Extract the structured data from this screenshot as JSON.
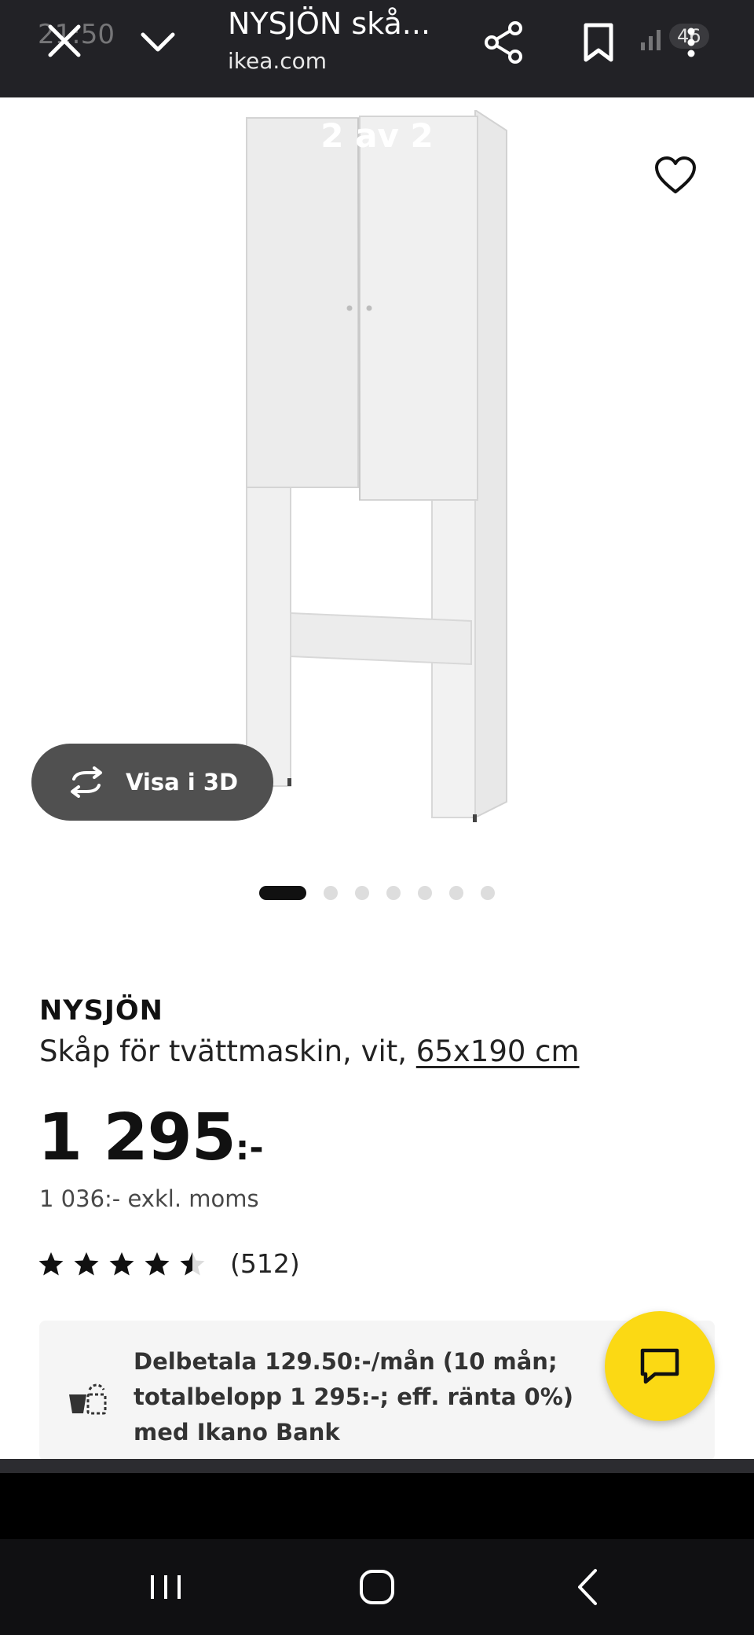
{
  "status_bar": {
    "time": "21:50",
    "battery": "46"
  },
  "browser": {
    "page_title": "NYSJÖN skå...",
    "url": "ikea.com"
  },
  "gallery": {
    "counter": "2 av 2",
    "view_3d_label": "Visa i 3D",
    "dot_count": 7,
    "active_dot": 0
  },
  "product": {
    "name": "NYSJÖN",
    "description": "Skåp för tvättmaskin, vit, ",
    "size_link": "65x190 cm",
    "price": "1 295",
    "price_suffix": ":-",
    "price_excl_vat": "1 036:- exkl. moms",
    "rating_value": 4.5,
    "rating_max": 5,
    "review_count": "(512)"
  },
  "installment": {
    "text": "Delbetala 129.50:-/mån (10 mån; totalbelopp 1 295:-; eff. ränta 0%) med Ikano Bank"
  },
  "colors": {
    "chat_button": "#fbd914",
    "topbar": "#222226",
    "text": "#111111"
  },
  "icons": {
    "close": "close-icon",
    "collapse": "chevron-down-icon",
    "share": "share-icon",
    "bookmark": "bookmark-icon",
    "wishlist": "heart-icon",
    "rotate": "rotate-3d-icon",
    "chat": "chat-icon",
    "payment": "payment-icon"
  }
}
